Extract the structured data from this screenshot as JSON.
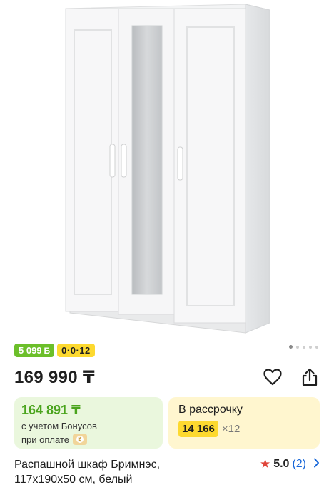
{
  "badges": {
    "bonus_value": "5 099",
    "bonus_icon": "Б",
    "installment": "0·0·12"
  },
  "carousel": {
    "total": 5,
    "active": 1
  },
  "price": "169 990 ₸",
  "actions": {
    "favorite_icon": "heart-icon",
    "share_icon": "share-icon"
  },
  "bonus_card": {
    "amount": "164 891 ₸",
    "line1": "с учетом Бонусов",
    "line2": "при оплате"
  },
  "installment_card": {
    "title": "В рассрочку",
    "monthly": "14 166",
    "months": "×12"
  },
  "product": {
    "name_line1": "Распашной шкаф Бримнэс,",
    "name_line2": "117x190x50 см, белый"
  },
  "rating": {
    "score": "5.0",
    "count": "(2)"
  },
  "colors": {
    "bonus_green": "#6cbf2a",
    "kaspi_yellow": "#fdd92f",
    "link_blue": "#1565d8",
    "star_red": "#e0453a"
  }
}
